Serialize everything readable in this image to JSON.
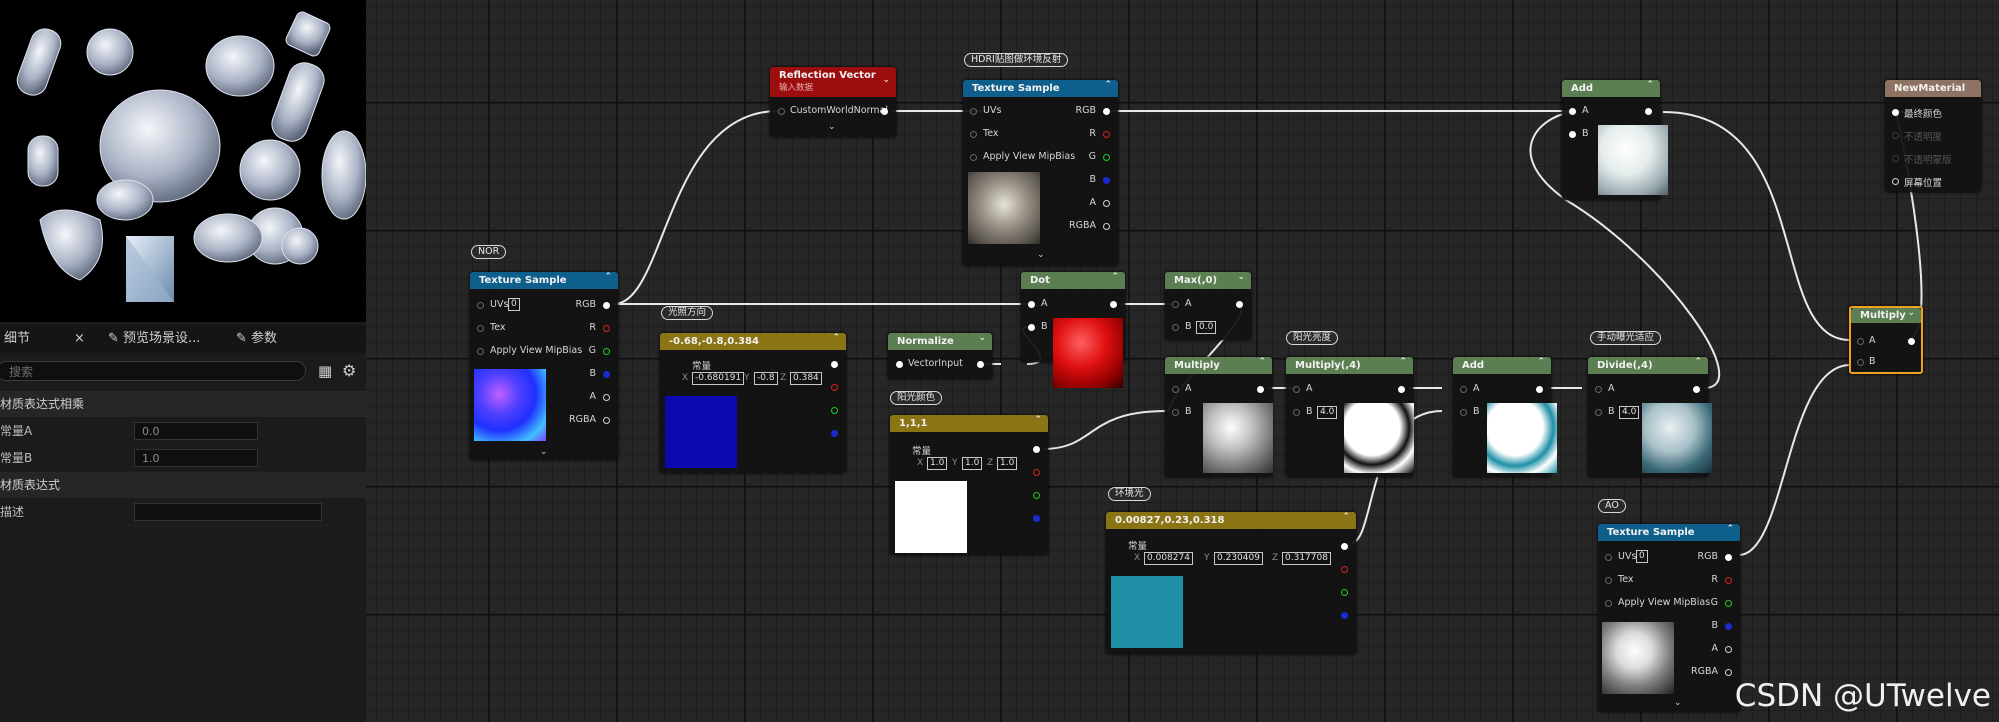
{
  "details_panel": {
    "tabs": [
      {
        "label": "细节",
        "close": "×"
      },
      {
        "label": "预览场景设..."
      },
      {
        "label": "参数"
      }
    ],
    "search_placeholder": "搜索",
    "sections": [
      {
        "title": "材质表达式相乘",
        "props": [
          {
            "name": "常量A",
            "value": "0.0"
          },
          {
            "name": "常量B",
            "value": "1.0"
          }
        ]
      },
      {
        "title": "材质表达式",
        "props": [
          {
            "name": "描述",
            "value": ""
          }
        ]
      }
    ]
  },
  "comments": {
    "nor": "NOR",
    "hdri": "HDRI贴图做环境反射",
    "light_dir": "光照方向",
    "sun_color": "阳光颜色",
    "sun_bright": "阳光亮度",
    "env_light": "环境光",
    "exposure": "手动曝光适应",
    "ao": "AO"
  },
  "nodes": {
    "tex_nor": {
      "title": "Texture Sample",
      "uvs": "UVs",
      "uv_value": "0",
      "tex": "Tex",
      "mip": "Apply View MipBias",
      "outs": [
        "RGB",
        "R",
        "G",
        "B",
        "A",
        "RGBA"
      ]
    },
    "refl": {
      "title": "Reflection Vector",
      "subtitle": "输入数据",
      "out": "CustomWorldNormal"
    },
    "tex_hdri": {
      "title": "Texture Sample",
      "uvs": "UVs",
      "tex": "Tex",
      "mip": "Apply View MipBias",
      "outs": [
        "RGB",
        "R",
        "G",
        "B",
        "A",
        "RGBA"
      ]
    },
    "const_dir": {
      "title": "-0.68,-0.8,0.384",
      "label": "常量",
      "x": "-0.680191",
      "y": "-0.8",
      "z": "0.384",
      "color": "#0a0ab0"
    },
    "normalize": {
      "title": "Normalize",
      "in": "VectorInput"
    },
    "dot": {
      "title": "Dot",
      "a": "A",
      "b": "B"
    },
    "max": {
      "title": "Max(,0)",
      "a": "A",
      "b": "B",
      "b_value": "0.0"
    },
    "const_sun": {
      "title": "1,1,1",
      "label": "常量",
      "x": "1.0",
      "y": "1.0",
      "z": "1.0",
      "color": "#ffffff"
    },
    "mul1": {
      "title": "Multiply",
      "a": "A",
      "b": "B"
    },
    "mul4": {
      "title": "Multiply(,4)",
      "a": "A",
      "b": "B",
      "b_value": "4.0"
    },
    "const_env": {
      "title": "0.00827,0.23,0.318",
      "label": "常量",
      "x": "0.008274",
      "y": "0.230409",
      "z": "0.317708",
      "color": "#1e8fa6"
    },
    "add_mid": {
      "title": "Add",
      "a": "A",
      "b": "B"
    },
    "div4": {
      "title": "Divide(,4)",
      "a": "A",
      "b": "B",
      "b_value": "4.0"
    },
    "add_top": {
      "title": "Add",
      "a": "A",
      "b": "B"
    },
    "tex_ao": {
      "title": "Texture Sample",
      "uvs": "UVs",
      "uv_value": "0",
      "tex": "Tex",
      "mip": "Apply View MipBias",
      "outs": [
        "RGB",
        "R",
        "G",
        "B",
        "A",
        "RGBA"
      ]
    },
    "mul_final": {
      "title": "Multiply",
      "a": "A",
      "b": "B"
    },
    "material": {
      "title": "NewMaterial",
      "pins": [
        "最终颜色",
        "不透明度",
        "不透明蒙版",
        "屏幕位置"
      ]
    }
  },
  "colors": {
    "texture_header": "#0e5f8c",
    "math_header": "#5b7f52",
    "const_header": "#8a7414",
    "refl_header": "#9c0d0d",
    "material_header": "#8e7262",
    "selection": "#f0a020"
  },
  "watermark": "CSDN @UTwelve"
}
